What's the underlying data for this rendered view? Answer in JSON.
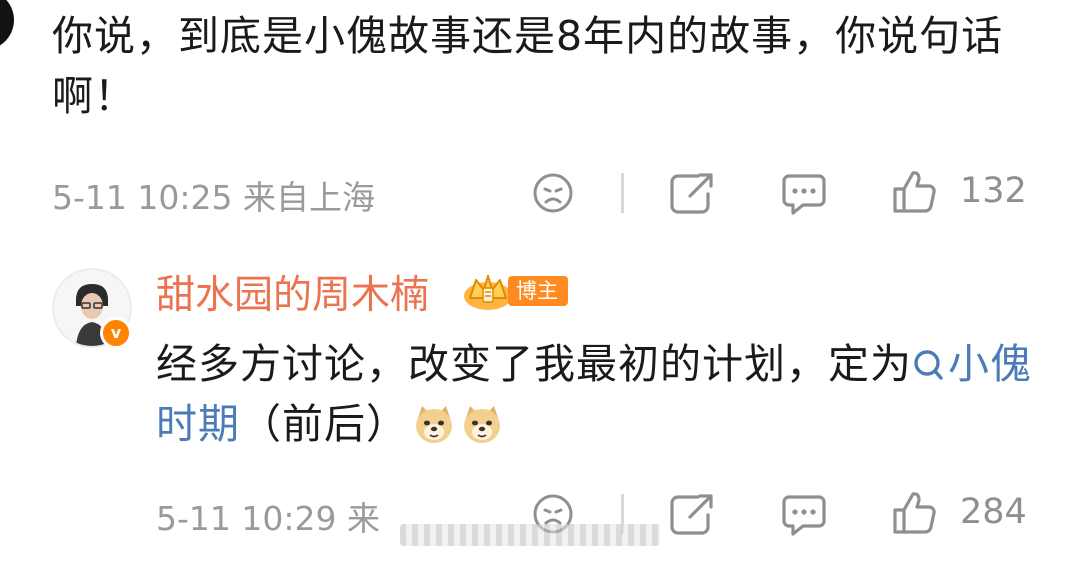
{
  "comment_1": {
    "text": "你说，到底是小傀故事还是8年内的故事，你说句话啊！",
    "meta": "5-11 10:25 来自上海",
    "like_count": "132"
  },
  "comment_2": {
    "username": "甜水园的周木楠",
    "host_badge_label": "博主",
    "verified_badge": "v",
    "text_before": "经多方讨论，改变了我最初的计划，定为",
    "topic": "小傀时期",
    "text_after": "（前后）",
    "meta": "5-11 10:29 来",
    "like_count": "284",
    "emojis": [
      "doge-emoji",
      "doge-emoji"
    ]
  },
  "icons": [
    "dislike-face-icon",
    "repost-icon",
    "comment-icon",
    "like-icon"
  ],
  "colors": {
    "username": "#eb7350",
    "topic": "#4b7cb8",
    "meta": "#9a9a9a",
    "host_badge": "#ff8a1f",
    "verified": "#ff8200"
  }
}
